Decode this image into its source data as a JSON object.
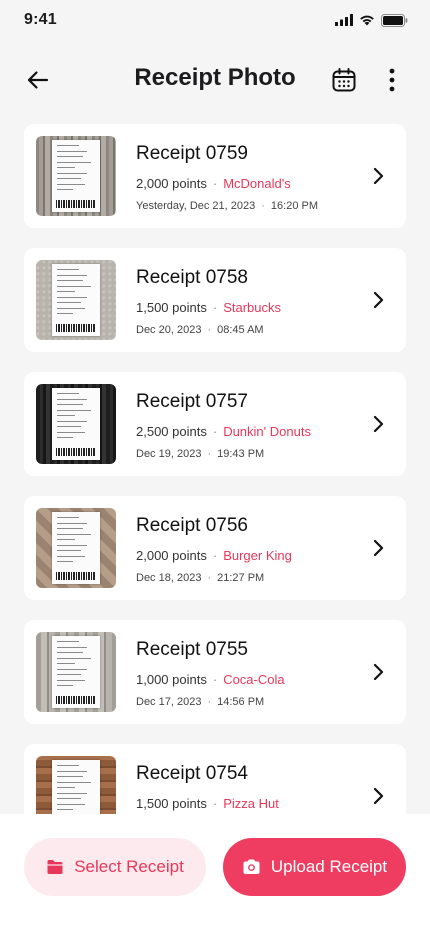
{
  "status_bar": {
    "time": "9:41"
  },
  "header": {
    "title": "Receipt Photo"
  },
  "icons": {
    "back": "arrow-left-icon",
    "calendar": "calendar-icon",
    "more": "more-vertical-icon"
  },
  "colors": {
    "accent": "#ef3d61",
    "accent_soft": "#fdeaee",
    "merchant": "#e8385a"
  },
  "receipts": [
    {
      "title": "Receipt 0759",
      "points": "2,000 points",
      "merchant": "McDonald's",
      "date": "Yesterday, Dec 21, 2023",
      "time": "16:20 PM",
      "bg": "wood-grey"
    },
    {
      "title": "Receipt 0758",
      "points": "1,500 points",
      "merchant": "Starbucks",
      "date": "Dec 20, 2023",
      "time": "08:45 AM",
      "bg": "concrete"
    },
    {
      "title": "Receipt 0757",
      "points": "2,500 points",
      "merchant": "Dunkin' Donuts",
      "date": "Dec 19, 2023",
      "time": "19:43 PM",
      "bg": "dark-wood"
    },
    {
      "title": "Receipt 0756",
      "points": "2,000 points",
      "merchant": "Burger King",
      "date": "Dec 18, 2023",
      "time": "21:27 PM",
      "bg": "herringbone"
    },
    {
      "title": "Receipt 0755",
      "points": "1,000 points",
      "merchant": "Coca-Cola",
      "date": "Dec 17, 2023",
      "time": "14:56 PM",
      "bg": "light-wood"
    },
    {
      "title": "Receipt 0754",
      "points": "1,500 points",
      "merchant": "Pizza Hut",
      "date": "",
      "time": "",
      "bg": "warm-wood"
    }
  ],
  "actions": {
    "select_label": "Select Receipt",
    "upload_label": "Upload Receipt"
  }
}
